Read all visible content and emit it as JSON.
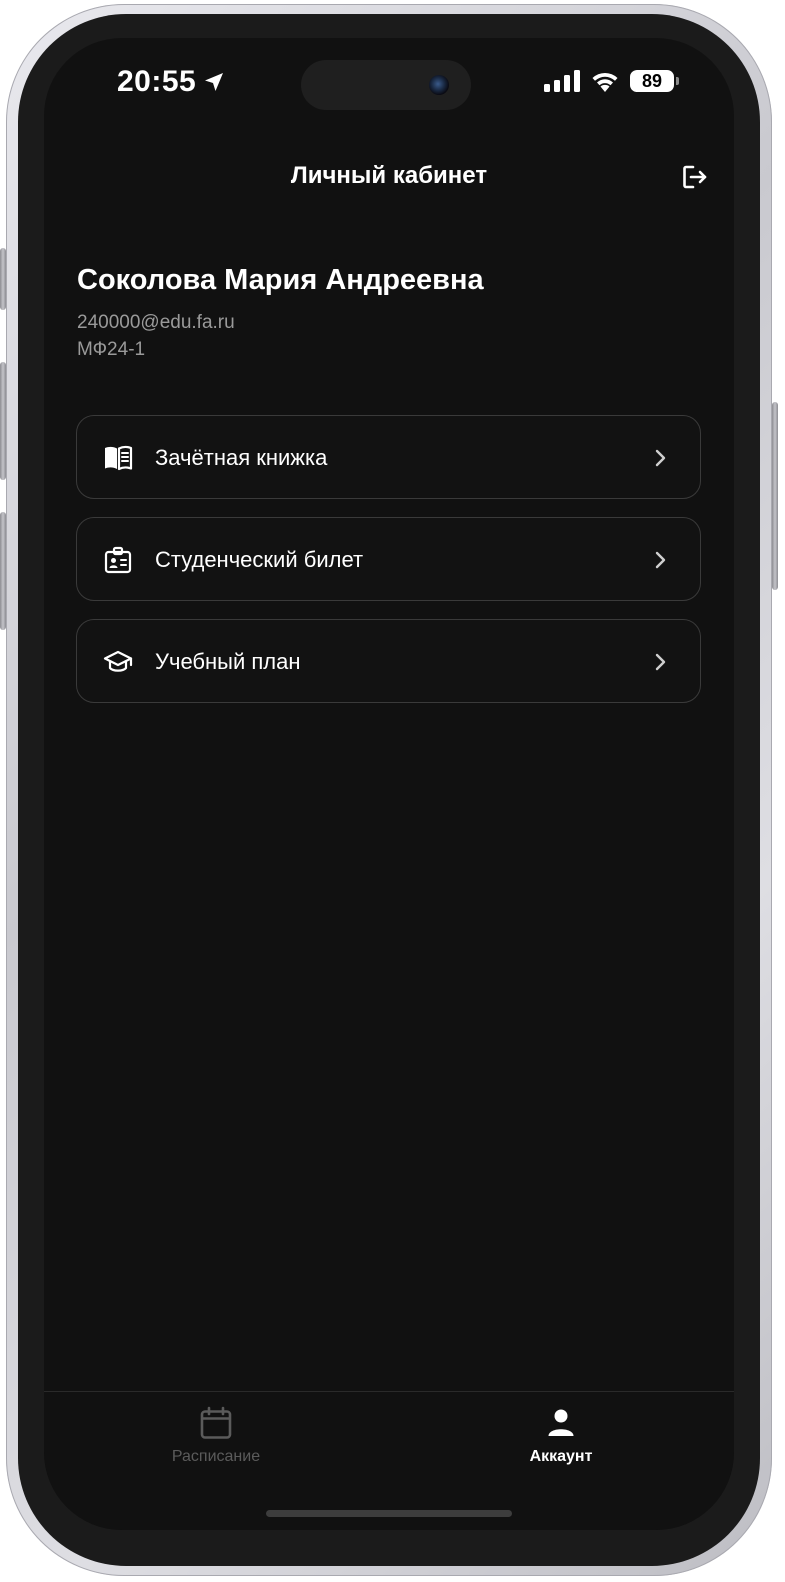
{
  "status_bar": {
    "time": "20:55",
    "battery": "89"
  },
  "header": {
    "title": "Личный кабинет"
  },
  "profile": {
    "name": "Соколова Мария Андреевна",
    "email": "240000@edu.fa.ru",
    "group": "МФ24-1"
  },
  "menu": {
    "items": [
      {
        "label": "Зачётная книжка",
        "icon": "book-icon"
      },
      {
        "label": "Студенческий билет",
        "icon": "id-card-icon"
      },
      {
        "label": "Учебный план",
        "icon": "graduation-cap-icon"
      }
    ]
  },
  "tabbar": {
    "tabs": [
      {
        "label": "Расписание",
        "icon": "calendar-icon",
        "active": false
      },
      {
        "label": "Аккаунт",
        "icon": "person-icon",
        "active": true
      }
    ]
  },
  "colors": {
    "background": "#111111",
    "text_primary": "#ffffff",
    "text_secondary": "#9a9a9a",
    "card_border": "#3a3a3a",
    "tab_inactive": "#5b5b5b"
  }
}
